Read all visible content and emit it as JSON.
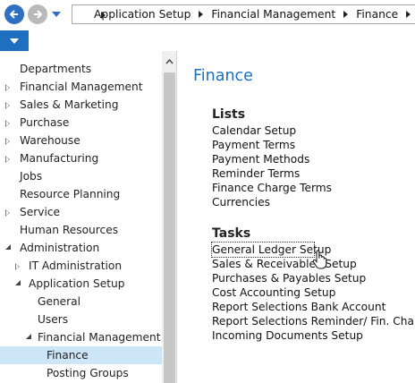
{
  "address_bar": {
    "breadcrumbs": [
      "Application Setup",
      "Financial Management",
      "Finance"
    ]
  },
  "nav_tree": {
    "items": [
      {
        "label": "Departments",
        "state": "none",
        "level": 0
      },
      {
        "label": "Financial Management",
        "state": "collapsed",
        "level": 0
      },
      {
        "label": "Sales & Marketing",
        "state": "collapsed",
        "level": 0
      },
      {
        "label": "Purchase",
        "state": "collapsed",
        "level": 0
      },
      {
        "label": "Warehouse",
        "state": "collapsed",
        "level": 0
      },
      {
        "label": "Manufacturing",
        "state": "collapsed",
        "level": 0
      },
      {
        "label": "Jobs",
        "state": "none",
        "level": 0
      },
      {
        "label": "Resource Planning",
        "state": "none",
        "level": 0
      },
      {
        "label": "Service",
        "state": "collapsed",
        "level": 0
      },
      {
        "label": "Human Resources",
        "state": "none",
        "level": 0
      },
      {
        "label": "Administration",
        "state": "expanded",
        "level": 0
      },
      {
        "label": "IT Administration",
        "state": "collapsed",
        "level": 1
      },
      {
        "label": "Application Setup",
        "state": "expanded",
        "level": 1
      },
      {
        "label": "General",
        "state": "none",
        "level": 2
      },
      {
        "label": "Users",
        "state": "none",
        "level": 2
      },
      {
        "label": "Financial Management",
        "state": "expanded",
        "level": 2
      },
      {
        "label": "Finance",
        "state": "none",
        "level": 3,
        "selected": true
      },
      {
        "label": "Posting Groups",
        "state": "none",
        "level": 3
      }
    ]
  },
  "content": {
    "title": "Finance",
    "lists": {
      "heading": "Lists",
      "items": [
        "Calendar Setup",
        "Payment Terms",
        "Payment Methods",
        "Reminder Terms",
        "Finance Charge Terms",
        "Currencies"
      ]
    },
    "tasks": {
      "heading": "Tasks",
      "items": [
        "General Ledger Setup",
        "Sales & Receivables Setup",
        "Purchases & Payables Setup",
        "Cost Accounting Setup",
        "Report Selections Bank Account",
        "Report Selections Reminder/ Fin. Charge",
        "Incoming Documents Setup"
      ]
    }
  },
  "colors": {
    "accent": "#1f6fc1",
    "selection": "#cde6f7"
  }
}
